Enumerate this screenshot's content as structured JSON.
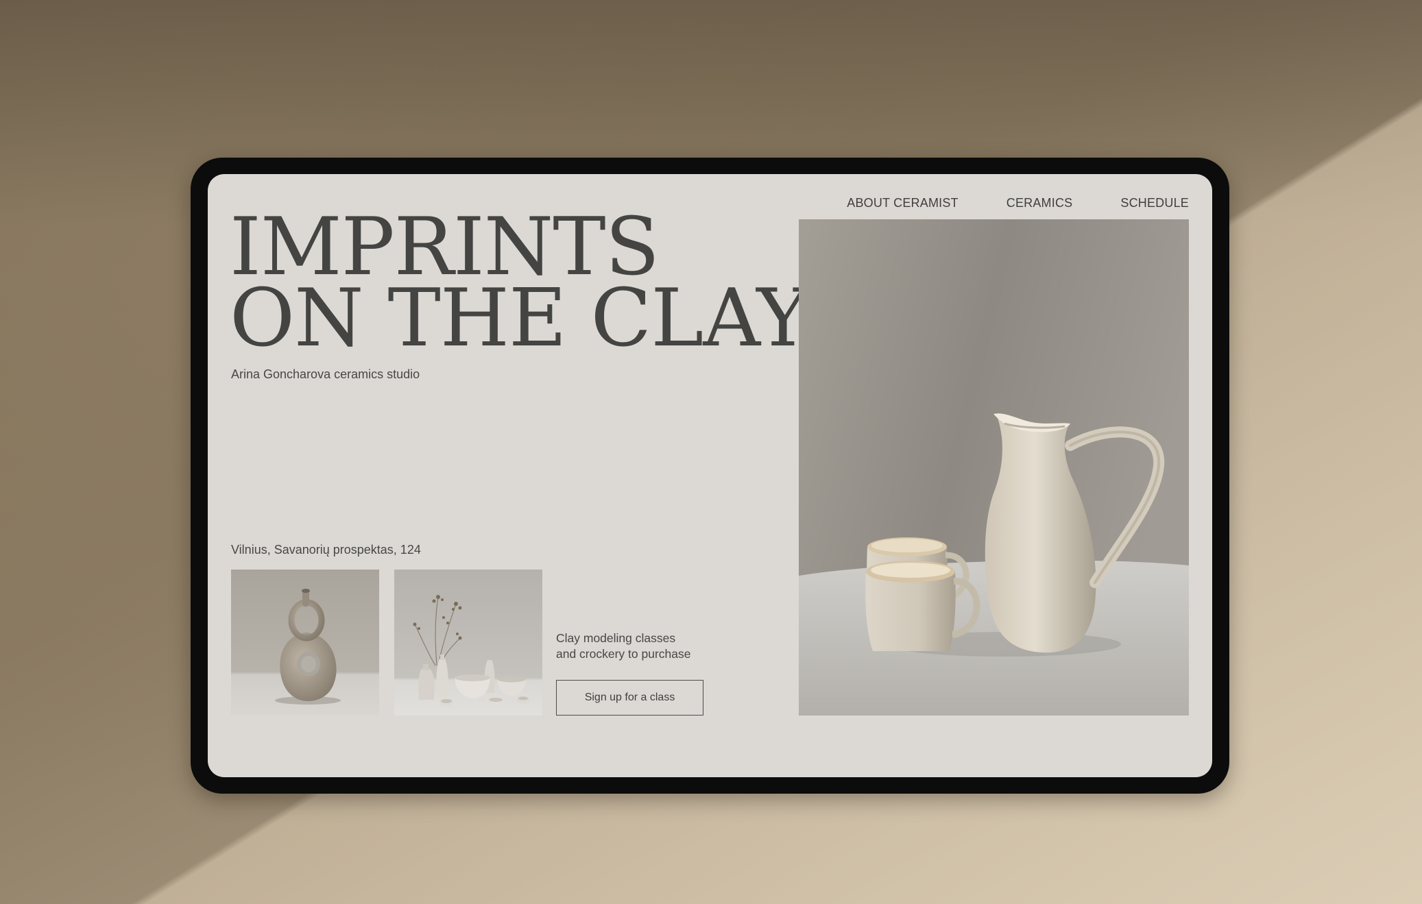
{
  "hero": {
    "title_line1": "IMPRINTS",
    "title_line2": "ON THE CLAY",
    "subtitle": "Arina Goncharova ceramics studio"
  },
  "nav": {
    "items": [
      {
        "label": "ABOUT CERAMIST"
      },
      {
        "label": "CERAMICS"
      },
      {
        "label": "SCHEDULE"
      }
    ]
  },
  "info": {
    "address": "Vilnius, Savanorių prospektas, 124",
    "description_line1": "Clay modeling classes",
    "description_line2": "and crockery to purchase",
    "cta_label": "Sign up for a class"
  },
  "colors": {
    "screen_bg": "#dcd9d5",
    "text": "#3c3c3a",
    "tablet_frame": "#0c0c0c"
  }
}
